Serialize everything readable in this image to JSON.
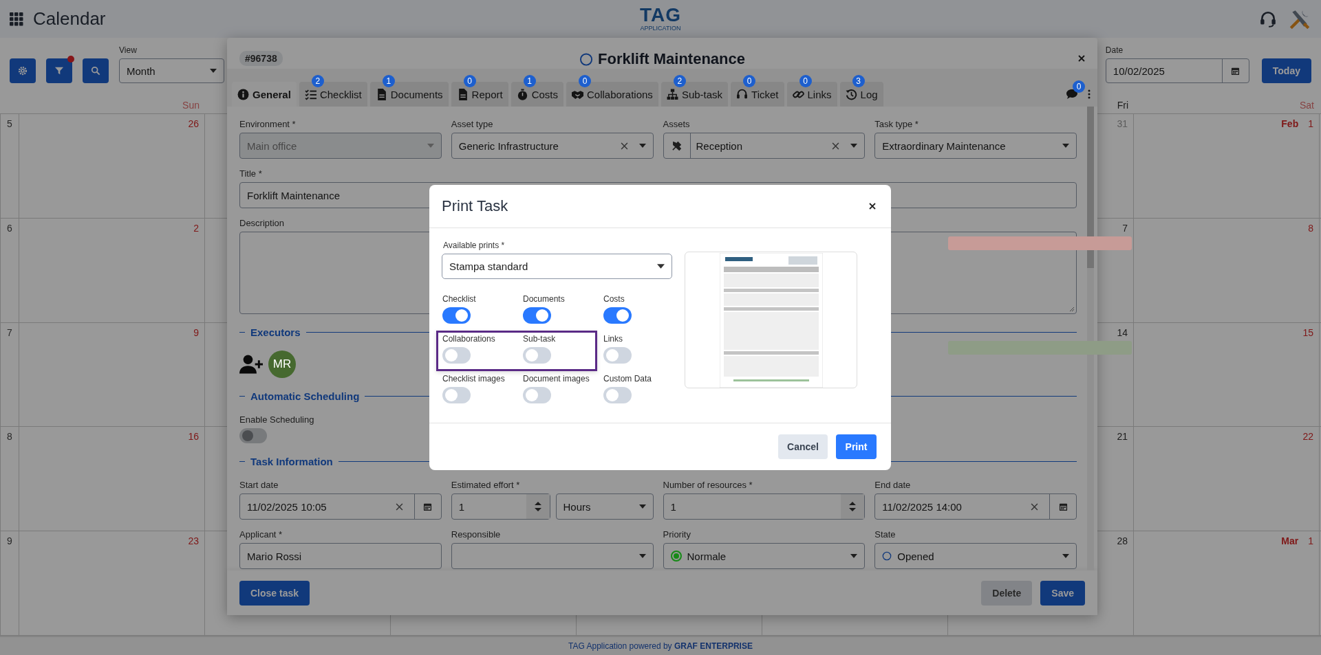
{
  "app_bar": {
    "title": "Calendar",
    "logo": {
      "name": "TAG",
      "subtitle": "APPLICATION"
    }
  },
  "calendar_toolbar": {
    "filter_active": true,
    "view": {
      "label": "View",
      "value": "Month"
    },
    "date": {
      "label": "Date",
      "value": "10/02/2025"
    },
    "today_button": "Today"
  },
  "calendar": {
    "day_headers": {
      "sun": "Sun",
      "fri": "Fri",
      "sat": "Sat"
    },
    "weeks": [
      {
        "week": "5",
        "sun": {
          "day": "26"
        },
        "fri": {
          "day": "31",
          "outside_month": true
        },
        "sat": {
          "month": "Feb",
          "day": "1"
        }
      },
      {
        "week": "6",
        "sun": {
          "day": "2"
        },
        "fri": {
          "day": "7",
          "outside_month": false,
          "events": [
            {
              "color": "#c79b97"
            }
          ]
        },
        "sat": {
          "day": "8"
        }
      },
      {
        "week": "7",
        "sun": {
          "day": "9"
        },
        "fri": {
          "day": "14",
          "outside_month": false,
          "events": [
            {
              "color": "#8e9c86"
            }
          ]
        },
        "sat": {
          "day": "15"
        }
      },
      {
        "week": "8",
        "sun": {
          "day": "16"
        },
        "fri": {
          "day": "21",
          "outside_month": false
        },
        "sat": {
          "day": "22"
        }
      },
      {
        "week": "9",
        "sun": {
          "day": "23"
        },
        "fri": {
          "day": "28",
          "outside_month": false
        },
        "sat": {
          "month": "Mar",
          "day": "1"
        }
      }
    ]
  },
  "task": {
    "id": "#96738",
    "title": "Forklift Maintenance",
    "tabs": [
      {
        "label": "General",
        "selected": true
      },
      {
        "label": "Checklist",
        "count": "2",
        "selected": false
      },
      {
        "label": "Documents",
        "count": "1",
        "selected": false
      },
      {
        "label": "Report",
        "count": "0",
        "selected": false
      },
      {
        "label": "Costs",
        "count": "1",
        "selected": false
      },
      {
        "label": "Collaborations",
        "count": "0",
        "selected": false
      },
      {
        "label": "Sub-task",
        "count": "2",
        "selected": false
      },
      {
        "label": "Ticket",
        "count": "0",
        "selected": false
      },
      {
        "label": "Links",
        "count": "0",
        "selected": false
      },
      {
        "label": "Log",
        "count": "3",
        "selected": false
      }
    ],
    "chat_count": "0",
    "top_fields": [
      {
        "kind": "select",
        "label": "Environment *",
        "value": "Main office",
        "disabled": true
      },
      {
        "kind": "select",
        "label": "Asset type",
        "value": "Generic Infrastructure",
        "clearable": true
      },
      {
        "kind": "select",
        "label": "Assets",
        "value": "Reception",
        "clearable": true,
        "prefix_icon": true
      },
      {
        "kind": "select",
        "label": "Task type *",
        "value": "Extraordinary Maintenance"
      }
    ],
    "title_field": {
      "label": "Title *",
      "value": "Forklift Maintenance"
    },
    "description": {
      "label": "Description"
    },
    "sections": {
      "executors": "Executors",
      "scheduling": "Automatic Scheduling",
      "info": "Task Information"
    },
    "executors": [
      {
        "initials": "MR",
        "color": "#46692f"
      }
    ],
    "enable_scheduling": {
      "label": "Enable Scheduling",
      "on": false,
      "disabled": true
    },
    "info_rows": [
      [
        {
          "kind": "date",
          "label": "Start date",
          "value": "11/02/2025 10:05"
        },
        {
          "kind": "number_unit",
          "label": "Estimated effort *",
          "value": "1",
          "unit": "Hours"
        },
        {
          "kind": "number",
          "label": "Number of resources *",
          "value": "1"
        },
        {
          "kind": "date",
          "label": "End date",
          "value": "11/02/2025 14:00"
        }
      ],
      [
        {
          "kind": "text",
          "label": "Applicant *",
          "value": "Mario Rossi"
        },
        {
          "kind": "select",
          "label": "Responsible"
        },
        {
          "kind": "select",
          "label": "Priority",
          "value": "Normale",
          "color": "#168a16"
        },
        {
          "kind": "select",
          "label": "State",
          "value": "Opened",
          "status_circle": true
        }
      ]
    ],
    "buttons": {
      "close": "Close task",
      "delete": "Delete",
      "save": "Save"
    }
  },
  "print_dialog": {
    "title": "Print Task",
    "select": {
      "label": "Available prints *",
      "value": "Stampa standard"
    },
    "options": [
      {
        "label": "Checklist",
        "on": true,
        "highlighted": false
      },
      {
        "label": "Documents",
        "on": true,
        "highlighted": false
      },
      {
        "label": "Costs",
        "on": true,
        "highlighted": false
      },
      {
        "label": "Collaborations",
        "on": false,
        "highlighted": true
      },
      {
        "label": "Sub-task",
        "on": false,
        "highlighted": true
      },
      {
        "label": "Links",
        "on": false,
        "highlighted": false
      },
      {
        "label": "Checklist images",
        "on": false,
        "highlighted": false
      },
      {
        "label": "Document images",
        "on": false,
        "highlighted": false
      },
      {
        "label": "Custom Data",
        "on": false,
        "highlighted": false
      }
    ],
    "buttons": {
      "cancel": "Cancel",
      "print": "Print"
    }
  },
  "footer": "TAG Application powered by **GRAF ENTERPRISE**"
}
